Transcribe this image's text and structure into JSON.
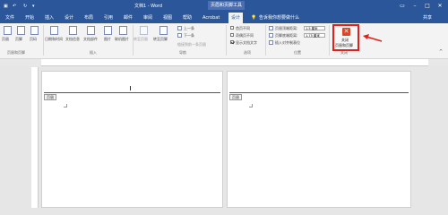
{
  "titlebar": {
    "doc_title": "文档1 - Word",
    "context_tab": "页眉和页脚工具"
  },
  "tabs": [
    "文件",
    "开始",
    "插入",
    "设计",
    "布局",
    "引用",
    "邮件",
    "审阅",
    "视图",
    "帮助",
    "Acrobat",
    "设计"
  ],
  "tell_me": "告诉我你想要做什么",
  "share": "共享",
  "ribbon": {
    "header_btn": "页眉",
    "footer_btn": "页脚",
    "page_num_btn": "页码",
    "date_time_btn": "日期和时间",
    "doc_info_btn": "文档信息",
    "doc_parts_btn": "文档部件",
    "picture_btn": "图片",
    "online_pic_btn": "联机图片",
    "goto_header_btn": "转至页眉",
    "goto_footer_btn": "转至页脚",
    "prev_btn": "上一条",
    "next_btn": "下一条",
    "link_prev_btn": "链接到前一条页眉",
    "diff_first_page": "首页不同",
    "diff_odd_even": "奇偶页不同",
    "show_doc_text": "显示文档文字",
    "header_top_label": "页眉顶端距离:",
    "header_top_value": "1.5 厘米",
    "footer_bottom_label": "页脚底端距离:",
    "footer_bottom_value": "1.75 厘米",
    "insert_align_tab": "插入对齐制表位",
    "close_label_1": "关闭",
    "close_label_2": "页眉和页脚"
  },
  "groups": {
    "header_footer": "页眉和页脚",
    "insert": "插入",
    "navigation": "导航",
    "options": "选项",
    "position": "位置",
    "close": "关闭"
  },
  "pages": [
    {
      "header_tag": "页眉"
    },
    {
      "header_tag": "页眉"
    }
  ],
  "colors": {
    "accent": "#2b579a",
    "highlight": "#e0201c"
  }
}
